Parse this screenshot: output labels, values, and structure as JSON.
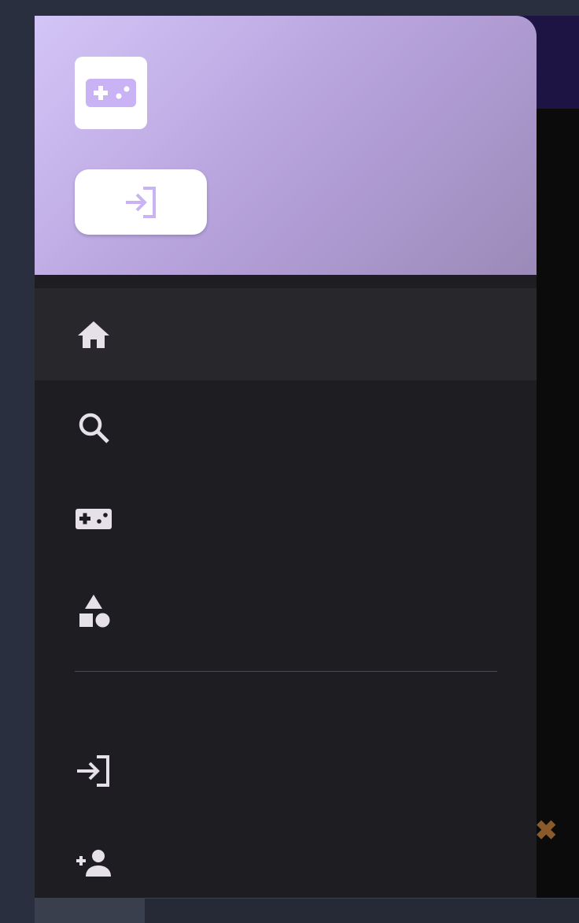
{
  "app": {
    "title": ""
  },
  "drawer": {
    "header": {
      "logo_icon": "gamepad-icon",
      "login_button_icon": "login-icon"
    },
    "nav": [
      {
        "id": "home",
        "label": "",
        "icon": "home-icon",
        "active": true
      },
      {
        "id": "search",
        "label": "",
        "icon": "search-icon",
        "active": false
      },
      {
        "id": "games",
        "label": "",
        "icon": "gamepad-icon",
        "active": false
      },
      {
        "id": "categories",
        "label": "",
        "icon": "category-shapes-icon",
        "active": false
      }
    ],
    "account": [
      {
        "id": "login",
        "label": "",
        "icon": "login-icon"
      },
      {
        "id": "register",
        "label": "",
        "icon": "person-add-icon"
      }
    ]
  },
  "colors": {
    "accent": "#c9b3f4",
    "header_gradient_start": "#d3c5f7",
    "header_gradient_end": "#9b8ab8",
    "drawer_bg": "#1e1d22",
    "icon": "#e6e1e9"
  }
}
